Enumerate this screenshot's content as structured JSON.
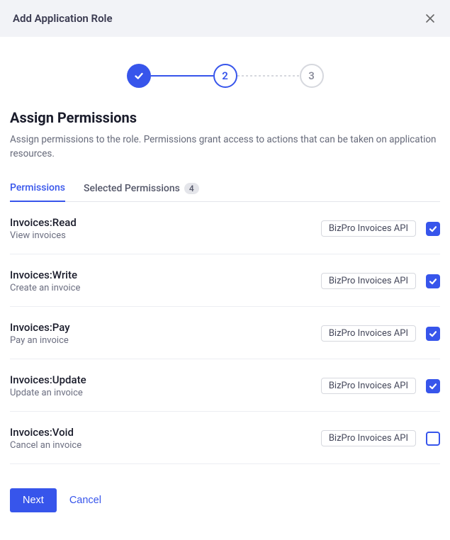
{
  "header": {
    "title": "Add Application Role"
  },
  "stepper": {
    "step2": "2",
    "step3": "3"
  },
  "section": {
    "title": "Assign Permissions",
    "description": "Assign permissions to the role. Permissions grant access to actions that can be taken on application resources."
  },
  "tabs": {
    "permissions": "Permissions",
    "selected": "Selected Permissions",
    "selected_count": "4"
  },
  "permissions": [
    {
      "name": "Invoices:Read",
      "desc": "View invoices",
      "api": "BizPro Invoices API",
      "checked": true
    },
    {
      "name": "Invoices:Write",
      "desc": "Create an invoice",
      "api": "BizPro Invoices API",
      "checked": true
    },
    {
      "name": "Invoices:Pay",
      "desc": "Pay an invoice",
      "api": "BizPro Invoices API",
      "checked": true
    },
    {
      "name": "Invoices:Update",
      "desc": "Update an invoice",
      "api": "BizPro Invoices API",
      "checked": true
    },
    {
      "name": "Invoices:Void",
      "desc": "Cancel an invoice",
      "api": "BizPro Invoices API",
      "checked": false
    }
  ],
  "footer": {
    "next": "Next",
    "cancel": "Cancel"
  }
}
